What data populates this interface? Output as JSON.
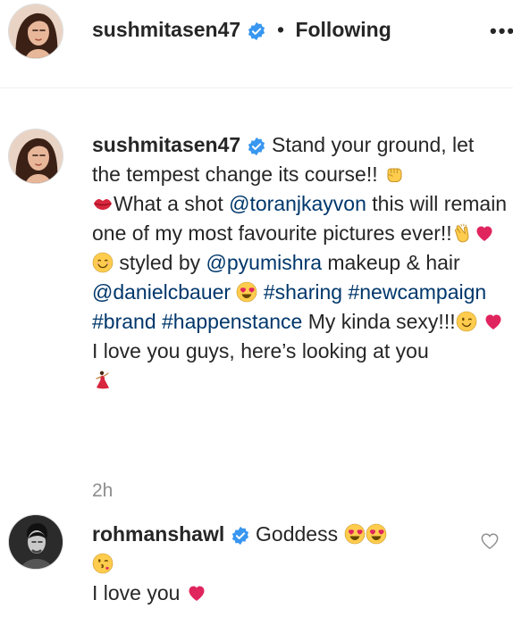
{
  "header": {
    "username": "sushmitasen47",
    "separator": "•",
    "follow_status": "Following",
    "more_label": "•••"
  },
  "caption": {
    "username": "sushmitasen47",
    "text_1": "Stand your ground, let the tempest change its course!!",
    "text_2": "What a shot",
    "mention_1": "@toranjkayvon",
    "text_3": "this will remain one of my most favourite pictures ever!!",
    "text_4": "styled by",
    "mention_2": "@pyumishra",
    "text_5": "makeup & hair",
    "mention_3": "@danielcbauer",
    "hashtag_1": "#sharing",
    "hashtag_2": "#newcampaign",
    "hashtag_3": "#brand",
    "hashtag_4": "#happenstance",
    "text_6": "My kinda sexy!!!",
    "text_7": "I love you guys, here’s looking at you",
    "time": "2h"
  },
  "comment": {
    "username": "rohmanshawl",
    "text_1": "Goddess",
    "text_2": "I love you"
  },
  "icons": {
    "verified": "verified-badge-icon",
    "like": "heart-outline-icon",
    "accent_blue": "#3897f0",
    "link_color": "#00376b"
  }
}
